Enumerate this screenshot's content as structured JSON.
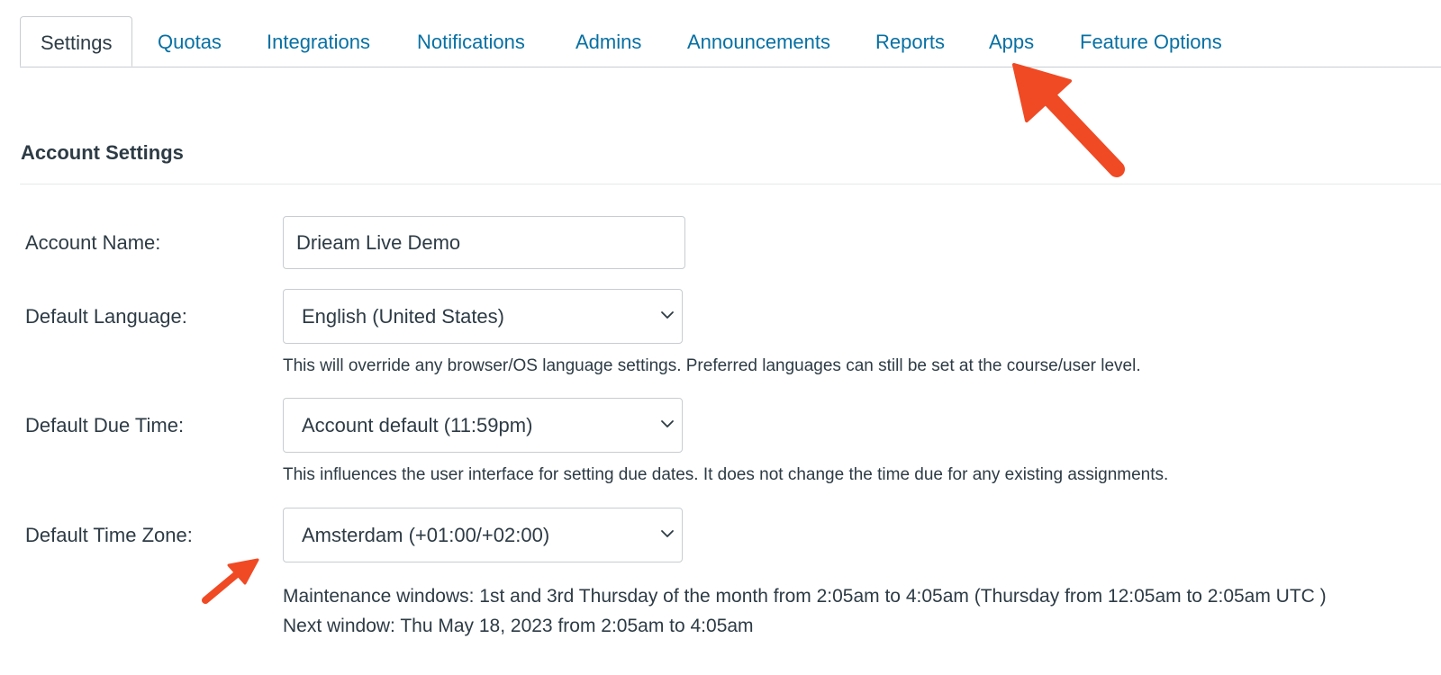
{
  "tabs": [
    {
      "label": "Settings",
      "active": true
    },
    {
      "label": "Quotas"
    },
    {
      "label": "Integrations"
    },
    {
      "label": "Notifications"
    },
    {
      "label": "Admins"
    },
    {
      "label": "Announcements"
    },
    {
      "label": "Reports"
    },
    {
      "label": "Apps"
    },
    {
      "label": "Feature Options"
    }
  ],
  "section": {
    "title": "Account Settings"
  },
  "form": {
    "account_name": {
      "label": "Account Name:",
      "value": "Drieam Live Demo"
    },
    "default_language": {
      "label": "Default Language:",
      "value": "English (United States)",
      "hint": "This will override any browser/OS language settings. Preferred languages can still be set at the course/user level."
    },
    "default_due_time": {
      "label": "Default Due Time:",
      "value": "Account default (11:59pm)",
      "hint": "This influences the user interface for setting due dates. It does not change the time due for any existing assignments."
    },
    "default_time_zone": {
      "label": "Default Time Zone:",
      "value": "Amsterdam (+01:00/+02:00)"
    }
  },
  "maintenance": {
    "line1": "Maintenance windows: 1st and 3rd Thursday of the month from 2:05am to 4:05am (Thursday from 12:05am to 2:05am UTC )",
    "line2": "Next window: Thu May 18, 2023 from 2:05am to 4:05am"
  },
  "colors": {
    "link": "#0770a3",
    "text": "#2d3b45",
    "border": "#c7cdd1",
    "annotation_arrow": "#f04a24"
  },
  "icons": {
    "select_chevron": "chevron-down-icon",
    "annotation": "arrow-annotation-icon"
  }
}
